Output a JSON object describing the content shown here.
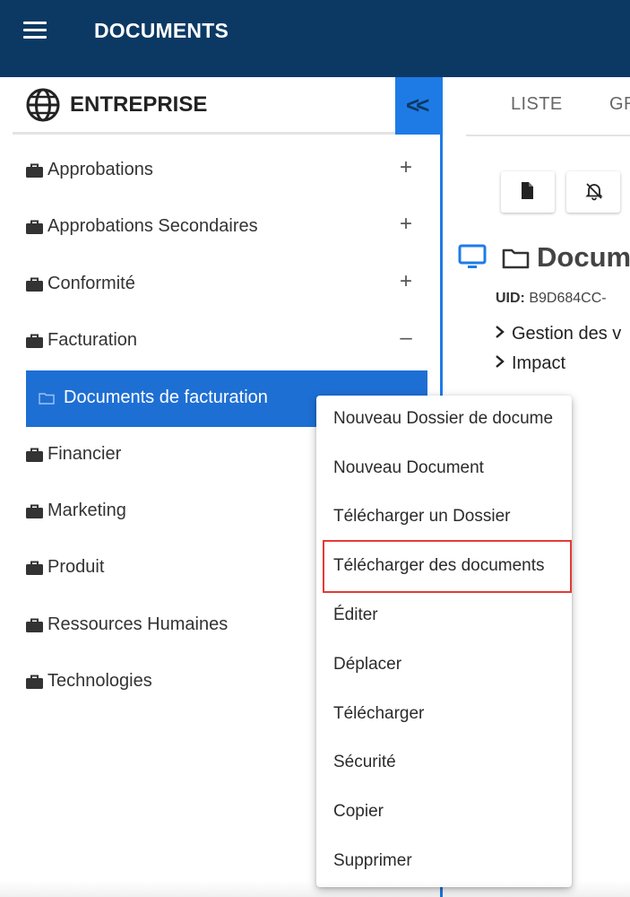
{
  "app": {
    "title": "DOCUMENTS"
  },
  "sidebar": {
    "title": "ENTREPRISE",
    "collapse_label": "<<",
    "items": [
      {
        "label": "Approbations",
        "toggle": "+"
      },
      {
        "label": "Approbations Secondaires",
        "toggle": "+"
      },
      {
        "label": "Conformité",
        "toggle": "+"
      },
      {
        "label": "Facturation",
        "toggle": "–"
      },
      {
        "label": "Financier",
        "toggle": ""
      },
      {
        "label": "Marketing",
        "toggle": ""
      },
      {
        "label": "Produit",
        "toggle": ""
      },
      {
        "label": "Ressources Humaines",
        "toggle": ""
      },
      {
        "label": "Technologies",
        "toggle": ""
      }
    ],
    "selected_child": {
      "label": "Documents de facturation"
    }
  },
  "main": {
    "tabs": [
      {
        "label": "LISTE"
      },
      {
        "label": "GR"
      }
    ],
    "doc_title": "Docum",
    "uid_label": "UID:",
    "uid_value": "B9D684CC-",
    "expand_items": [
      {
        "label": "Gestion des v"
      },
      {
        "label": "Impact"
      }
    ]
  },
  "context_menu": {
    "items": [
      {
        "label": "Nouveau Dossier de docume"
      },
      {
        "label": "Nouveau Document"
      },
      {
        "label": "Télécharger un Dossier"
      },
      {
        "label": "Télécharger des documents"
      },
      {
        "label": "Éditer"
      },
      {
        "label": "Déplacer"
      },
      {
        "label": "Télécharger"
      },
      {
        "label": "Sécurité"
      },
      {
        "label": "Copier"
      },
      {
        "label": "Supprimer"
      }
    ],
    "highlighted_item": "Télécharger des documents"
  },
  "colors": {
    "appbar": "#0b3963",
    "accent": "#1e7be6",
    "selected": "#1e6fd4",
    "highlight": "#e43b35"
  },
  "icons": {
    "menu": "hamburger-icon",
    "sidebar_header": "globe-icon",
    "tree_item": "briefcase-icon",
    "selected_child": "folder-icon",
    "toolbar": [
      "new-document-icon",
      "notifications-off-icon"
    ],
    "doc_title": [
      "monitor-icon",
      "folder-icon"
    ],
    "expand": "chevron-right-icon"
  }
}
